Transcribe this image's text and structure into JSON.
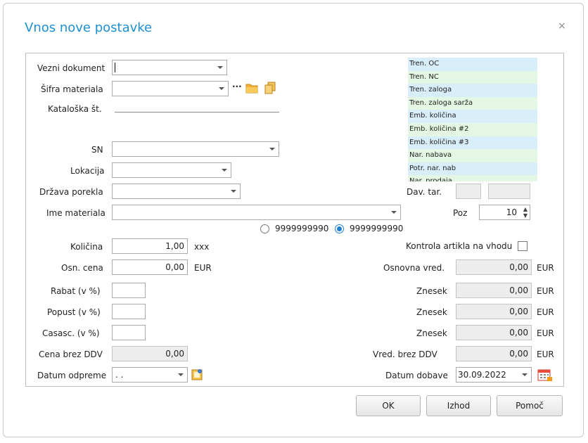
{
  "dialog": {
    "title": "Vnos nove postavke",
    "close": "×"
  },
  "labels": {
    "vezni_dokument": "Vezni dokument",
    "sifra_materiala": "Šifra materiala",
    "kataloska": "Kataloška št.",
    "sn": "SN",
    "lokacija": "Lokacija",
    "drzava": "Država porekla",
    "ime_materiala": "Ime materiala",
    "kolicina": "Količina",
    "osn_cena": "Osn. cena",
    "rabat": "Rabat (v %)",
    "popust": "Popust (v %)",
    "casasc": "Casasc. (v %)",
    "cena_brez_ddv": "Cena brez DDV",
    "datum_odpreme": "Datum odpreme",
    "dav_tar": "Dav. tar.",
    "poz": "Poz",
    "kontrola": "Kontrola artikla na vhodu",
    "osnovna_vred": "Osnovna vred.",
    "znesek": "Znesek",
    "vred_brez_ddv": "Vred. brez DDV",
    "datum_dobave": "Datum dobave"
  },
  "values": {
    "kolicina": "1,00",
    "kolicina_unit": "xxx",
    "osn_cena": "0,00",
    "currency": "EUR",
    "cena_brez_ddv": "0,00",
    "datum_odpreme": " .  .",
    "poz": "10",
    "osnovna_vred": "0,00",
    "znesek1": "0,00",
    "znesek2": "0,00",
    "znesek3": "0,00",
    "vred_brez_ddv": "0,00",
    "datum_dobave": "30.09.2022",
    "radio1": "9999999990",
    "radio2": "9999999990",
    "sifra_dots": "···"
  },
  "info_list": [
    "Tren. OC",
    "Tren. NC",
    "Tren. zaloga",
    "Tren. zaloga sarža",
    "Emb. količina",
    "Emb. količina #2",
    "Emb. količina #3",
    "Nar. nabava",
    "Potr. nar. nab",
    "Nar. prodaja"
  ],
  "buttons": {
    "ok": "OK",
    "izhod": "Izhod",
    "pomoc": "Pomoč"
  },
  "colors": {
    "title": "#1e8fd0",
    "info_a": "#d9eefb",
    "info_b": "#e4f7e4"
  },
  "icons": {
    "folder": "folder-icon",
    "copy": "copy-icon",
    "calendar": "calendar-icon",
    "date_picker": "date-picker-icon"
  }
}
